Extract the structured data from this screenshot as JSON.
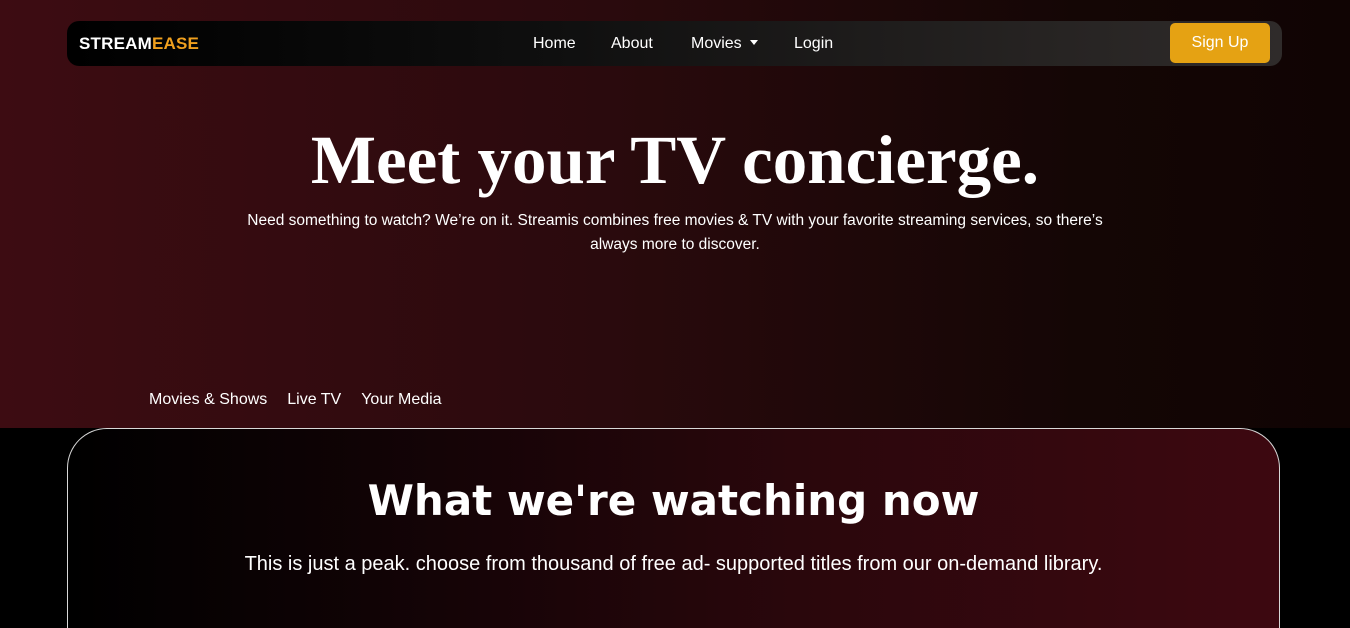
{
  "brand": {
    "part1": "STREAM",
    "part2": "EASE"
  },
  "nav": {
    "home": "Home",
    "about": "About",
    "movies": "Movies",
    "login": "Login",
    "signup": "Sign Up"
  },
  "hero": {
    "title": "Meet your TV concierge.",
    "subtitle": "Need something to watch? We’re on it. Streamis combines free movies & TV with your favorite streaming services, so there’s always more to discover.",
    "tabs": [
      "Movies & Shows",
      "Live TV",
      "Your Media"
    ]
  },
  "watching": {
    "title": "What we're watching now",
    "subtitle": "This is just a peak. choose from thousand of free ad- supported titles from our on-demand library."
  },
  "colors": {
    "accent": "#e5a213",
    "brand_highlight": "#f0a01e",
    "hero_bg_left": "#3d0c12",
    "hero_bg_right": "#100403",
    "page_bg": "#000000"
  },
  "icons": {
    "movies_dropdown": "caret-down-icon"
  }
}
